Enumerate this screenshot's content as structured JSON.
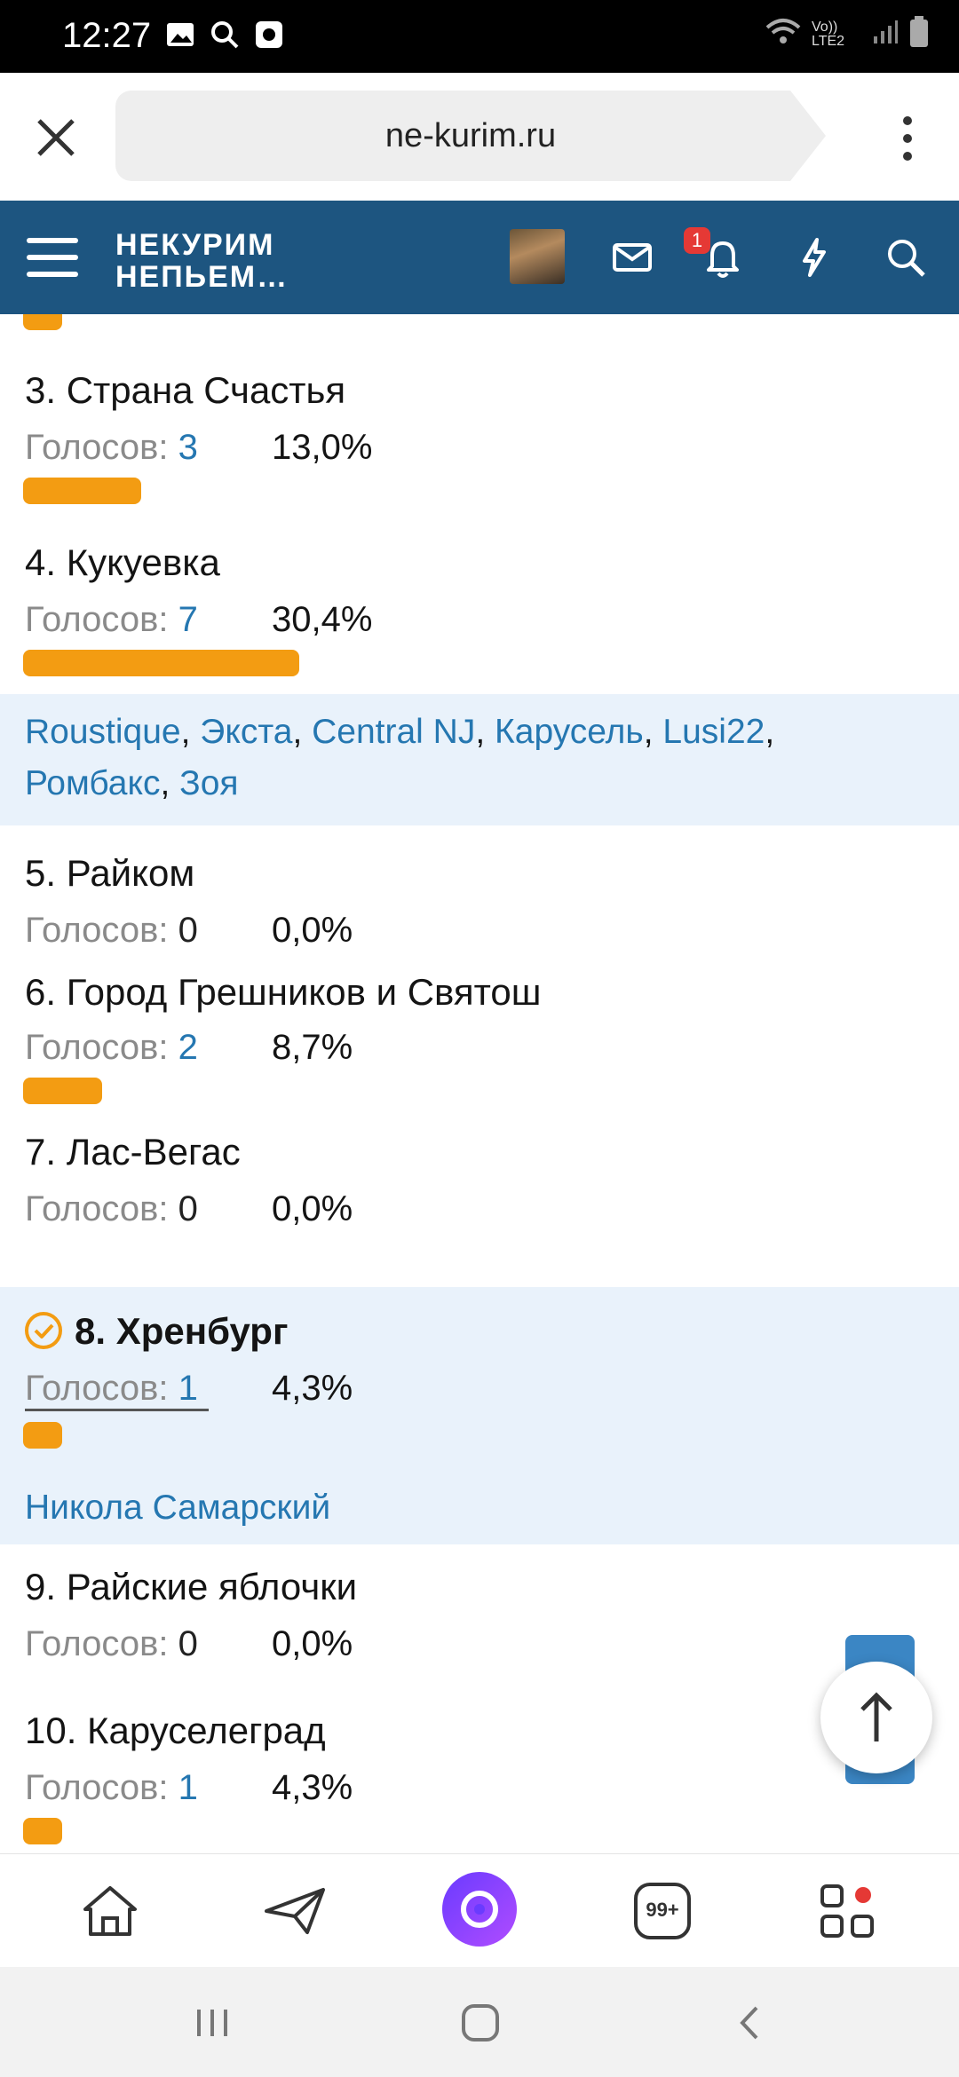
{
  "status_bar": {
    "time": "12:27",
    "network_label": "Vo)) LTE2"
  },
  "browser": {
    "url": "ne-kurim.ru"
  },
  "forum_header": {
    "logo_line1": "НЕКУРИМ",
    "logo_line2": "НЕПЬЕМ…",
    "notification_count": "1"
  },
  "poll": {
    "votes_label": "Голосов:",
    "options": [
      {
        "title": "3. Страна Счастья",
        "votes": "3",
        "percent": "13,0%",
        "fraction": 0.13
      },
      {
        "title": "4. Кукуевка",
        "votes": "7",
        "percent": "30,4%",
        "fraction": 0.304,
        "voters": [
          "Roustique",
          "Экста",
          "Central NJ",
          "Карусель",
          "Lusi22",
          "Ромбакс",
          "Зоя"
        ]
      },
      {
        "title": "5. Райком",
        "votes": "0",
        "percent": "0,0%",
        "fraction": 0.0
      },
      {
        "title": "6. Город Грешников и Святош",
        "votes": "2",
        "percent": "8,7%",
        "fraction": 0.087
      },
      {
        "title": "7. Лас-Вегас",
        "votes": "0",
        "percent": "0,0%",
        "fraction": 0.0
      },
      {
        "title": "8. Хренбург",
        "votes": "1",
        "percent": "4,3%",
        "fraction": 0.043,
        "selected": true,
        "voters": [
          "Никола Самарский"
        ]
      },
      {
        "title": "9. Райские яблочки",
        "votes": "0",
        "percent": "0,0%",
        "fraction": 0.0
      },
      {
        "title": "10. Каруселеград",
        "votes": "1",
        "percent": "4,3%",
        "fraction": 0.043
      }
    ]
  },
  "app_bar": {
    "notifications_badge": "99+"
  },
  "colors": {
    "header_blue": "#1d5580",
    "link_blue": "#2577b1",
    "bar_orange": "#f39c12",
    "voters_bg": "#e9f2fb"
  },
  "icons": [
    "image-icon",
    "search-icon",
    "record-icon",
    "wifi-icon",
    "signal-icon",
    "battery-icon",
    "close-icon",
    "more-vert-icon",
    "menu-icon",
    "mail-icon",
    "bell-icon",
    "lightning-icon",
    "search-icon",
    "check-circle-icon",
    "arrow-up-icon",
    "home-icon",
    "send-icon",
    "alice-icon",
    "badge-icon",
    "apps-icon",
    "recents-icon",
    "home-nav-icon",
    "back-icon"
  ]
}
